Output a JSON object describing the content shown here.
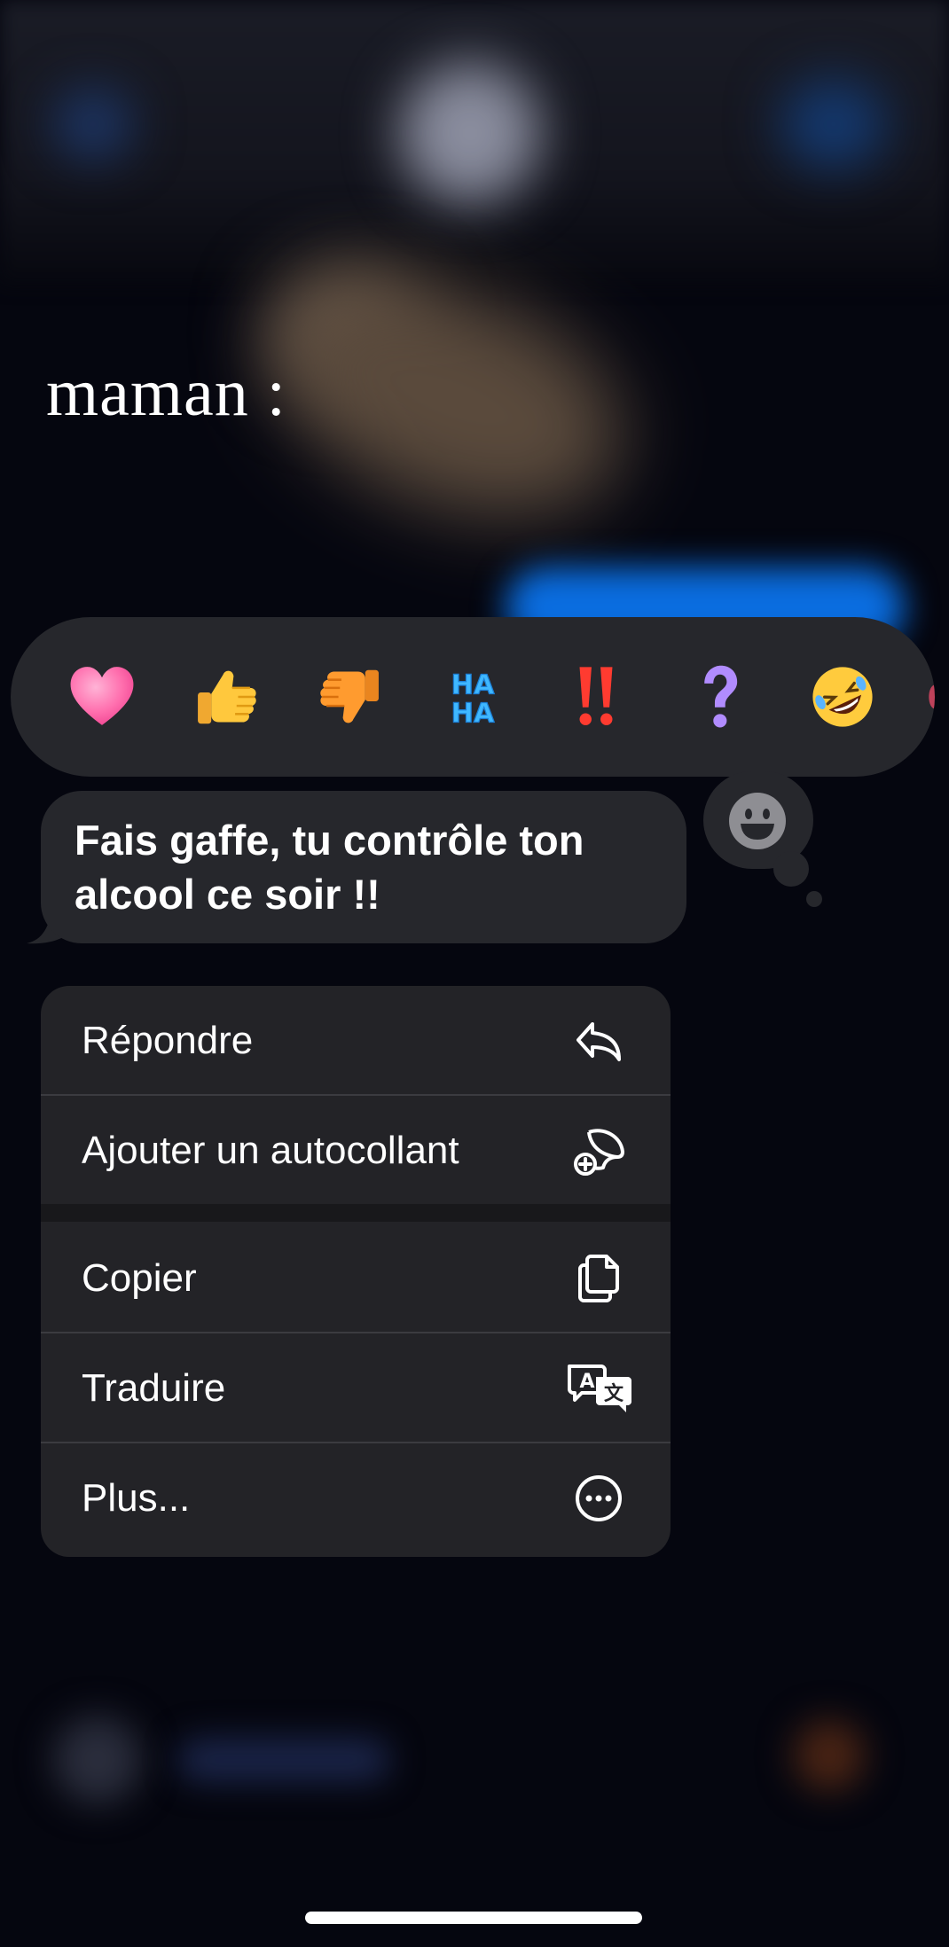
{
  "caption": "maman :",
  "reactions": [
    {
      "icon": "heart-icon"
    },
    {
      "icon": "thumbs-up-icon"
    },
    {
      "icon": "thumbs-down-icon"
    },
    {
      "icon": "haha-icon",
      "text": "HAHA"
    },
    {
      "icon": "double-exclamation-icon",
      "text": "‼"
    },
    {
      "icon": "question-mark-icon",
      "text": "?"
    },
    {
      "icon": "rolling-laughing-icon"
    }
  ],
  "message": {
    "text": "Fais gaffe, tu contrôle ton alcool ce soir !!"
  },
  "menu": {
    "items": [
      {
        "label": "Répondre",
        "icon": "reply-icon"
      },
      {
        "label": "Ajouter un autocollant",
        "icon": "add-sticker-icon"
      },
      {
        "label": "Copier",
        "icon": "copy-icon"
      },
      {
        "label": "Traduire",
        "icon": "translate-icon"
      },
      {
        "label": "Plus...",
        "icon": "more-circle-icon"
      }
    ]
  },
  "colors": {
    "background": "#05060f",
    "panel": "#26272c",
    "menu": "#232327",
    "text": "#ffffff",
    "heart": "#ff6fae",
    "haha": "#3fb8ff",
    "exclamation": "#ff3b30",
    "question": "#b18cff"
  }
}
